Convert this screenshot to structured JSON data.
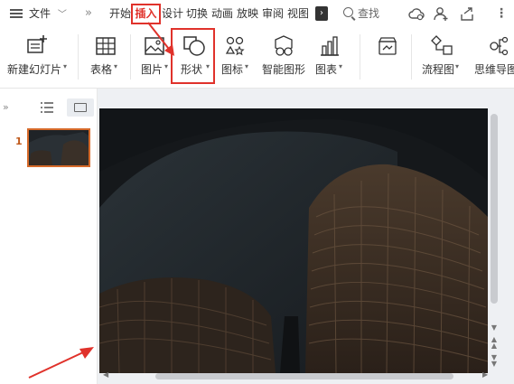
{
  "menu": {
    "file_label": "文件",
    "tabs": [
      "开始",
      "插入",
      "设计",
      "切换",
      "动画",
      "放映",
      "审阅",
      "视图"
    ],
    "active_tab": "插入",
    "search_label": "查找"
  },
  "ribbon": {
    "items": [
      {
        "label": "新建幻灯片",
        "has_dropdown": true,
        "icon": "new-slide-icon"
      },
      {
        "label": "表格",
        "has_dropdown": true,
        "icon": "table-icon"
      },
      {
        "label": "图片",
        "has_dropdown": true,
        "icon": "picture-icon"
      },
      {
        "label": "形状",
        "has_dropdown": true,
        "icon": "shape-icon"
      },
      {
        "label": "图标",
        "has_dropdown": true,
        "icon": "icons-icon"
      },
      {
        "label": "智能图形",
        "has_dropdown": false,
        "icon": "smartart-icon"
      },
      {
        "label": "图表",
        "has_dropdown": true,
        "icon": "chart-icon"
      },
      {
        "label": "",
        "has_dropdown": false,
        "icon": "online-resource-icon"
      },
      {
        "label": "流程图",
        "has_dropdown": true,
        "icon": "flowchart-icon"
      },
      {
        "label": "思维导图",
        "has_dropdown": false,
        "icon": "mindmap-icon"
      }
    ]
  },
  "slides_panel": {
    "slide_number": "1"
  },
  "colors": {
    "accent_red": "#e0322b",
    "thumb_border": "#d66a2a"
  }
}
